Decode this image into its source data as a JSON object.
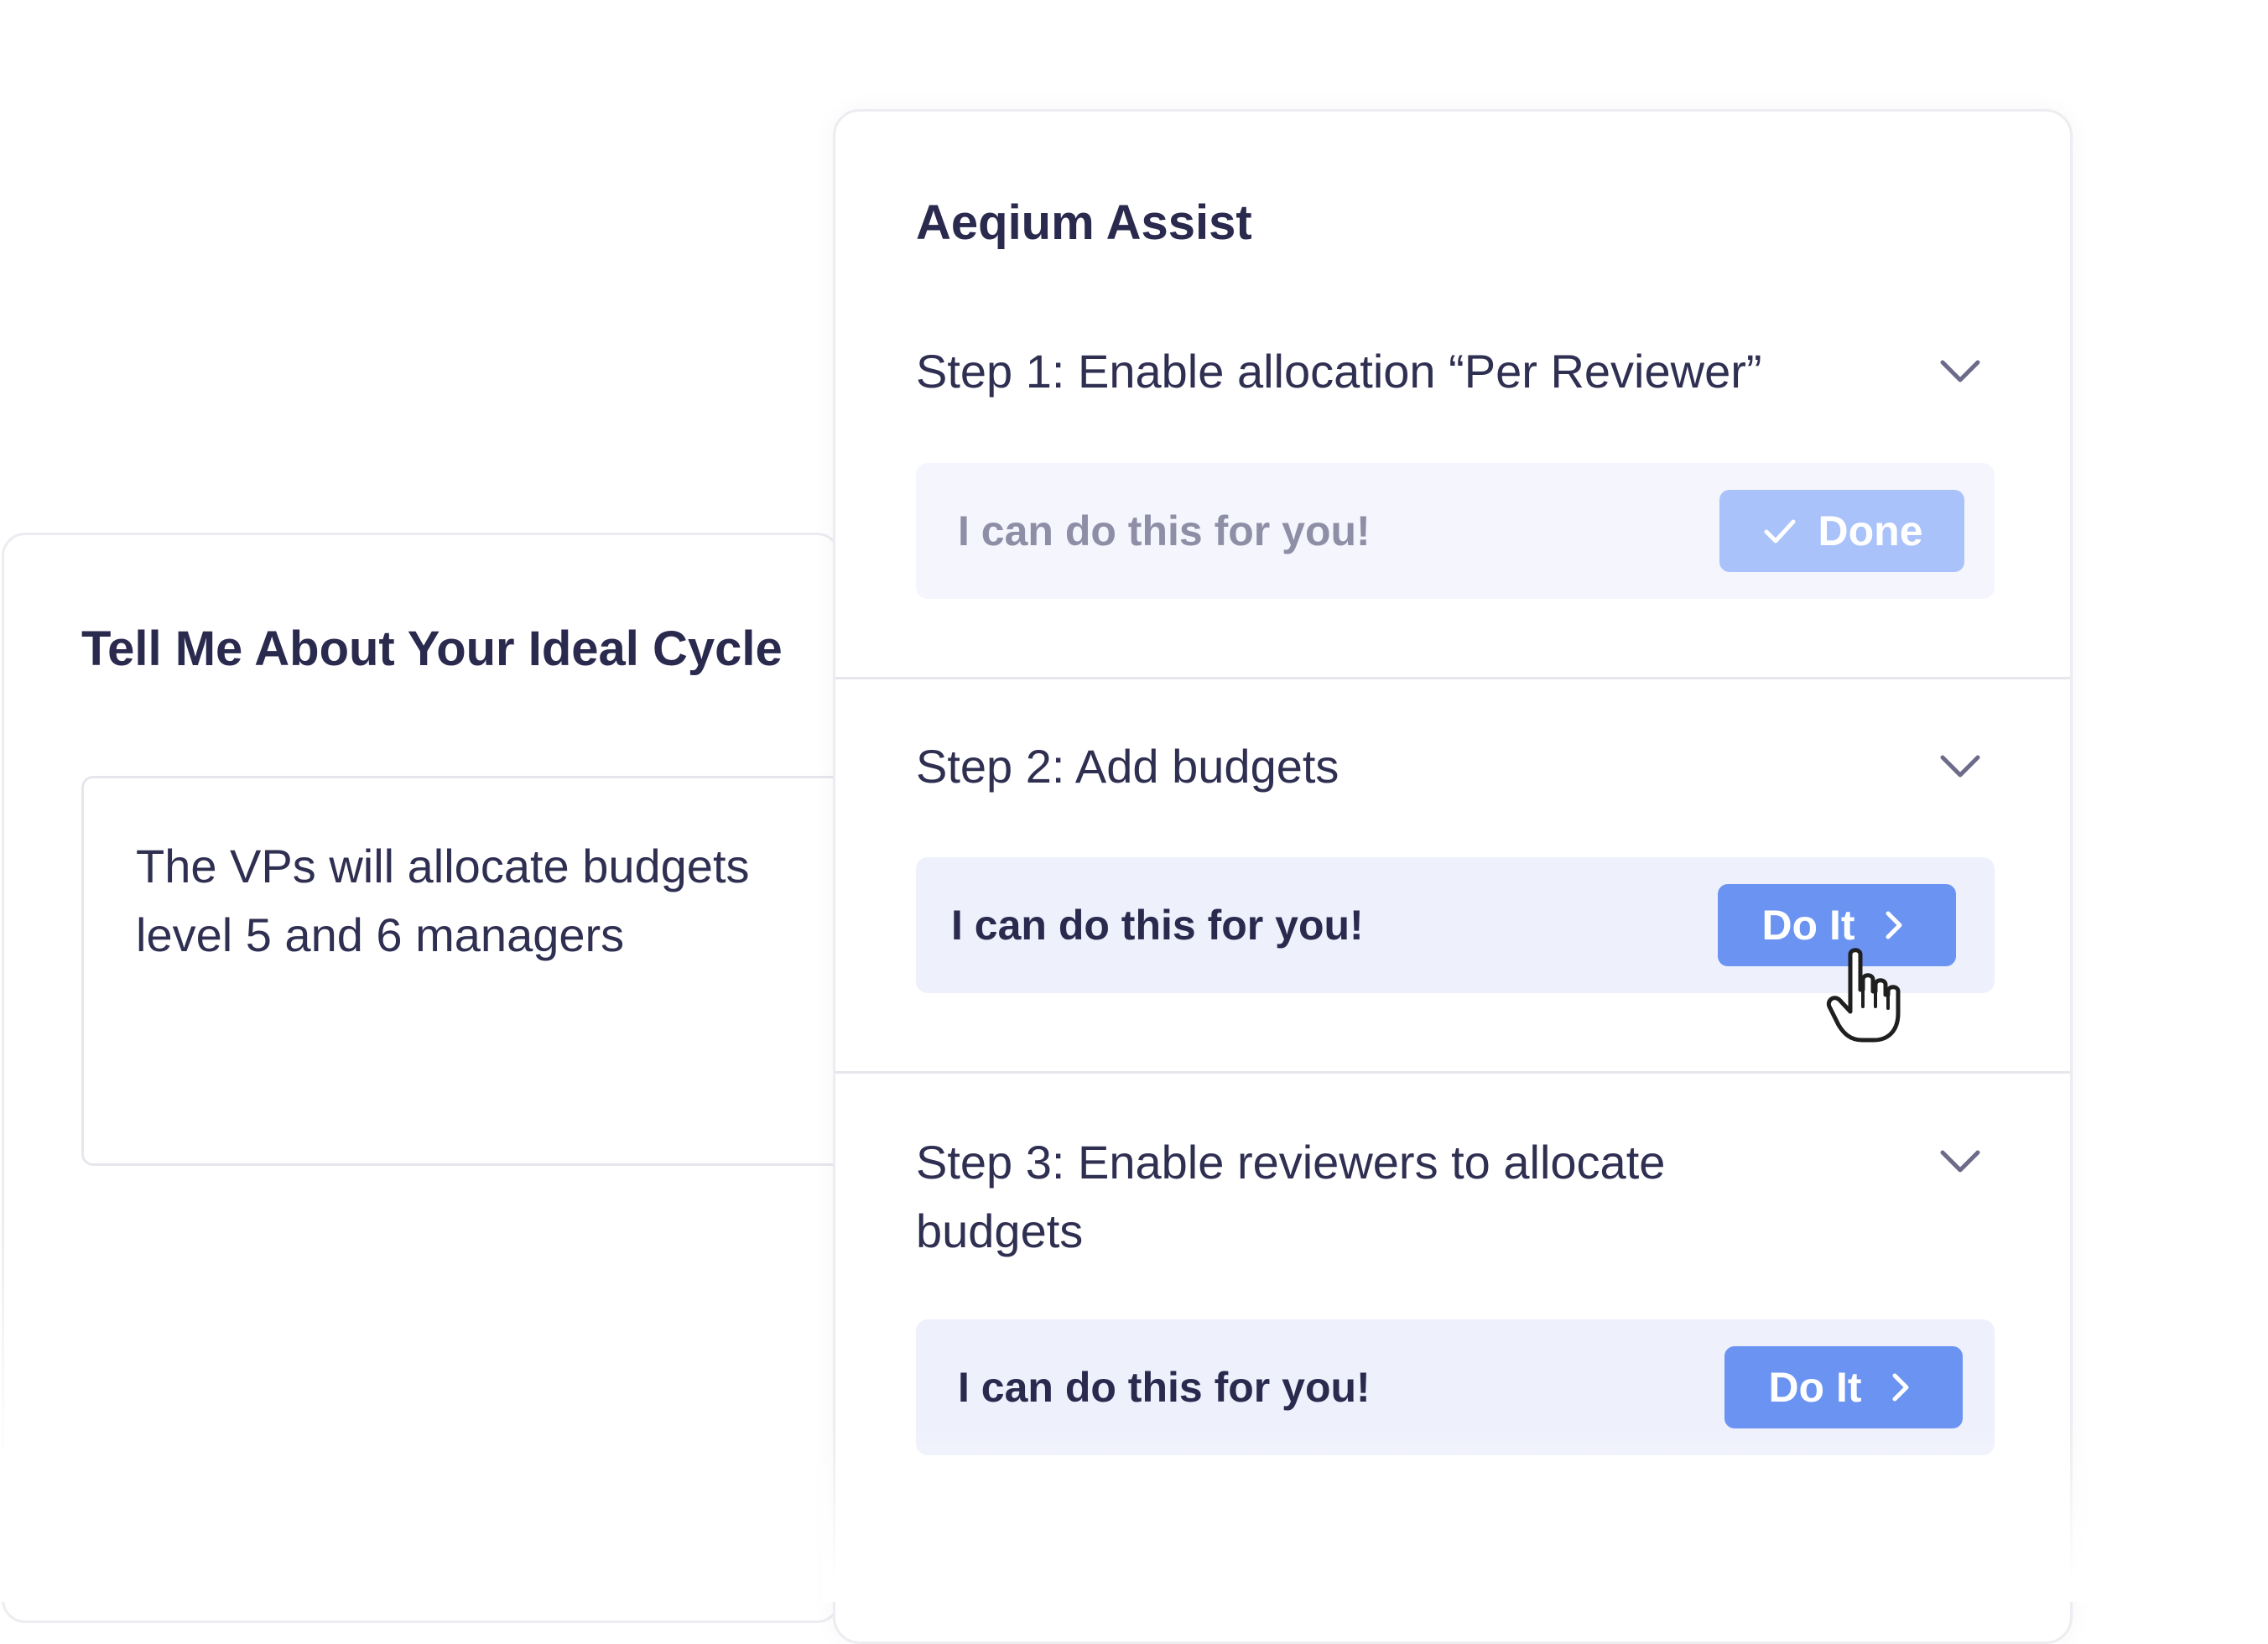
{
  "ideal_cycle": {
    "title": "Tell Me About Your Ideal Cycle",
    "input_value": "The VPs will allocate budgets\nlevel 5 and 6 managers"
  },
  "assist": {
    "title": "Aeqium Assist",
    "steps": [
      {
        "title": "Step 1: Enable allocation “Per Reviewer”",
        "action_text": "I can do this for you!",
        "button_label": "Done",
        "button_icon": "check-icon",
        "status": "done"
      },
      {
        "title": "Step 2: Add budgets",
        "action_text": "I can do this for you!",
        "button_label": "Do It",
        "button_icon": "chevron-right-icon",
        "status": "pending"
      },
      {
        "title": "Step 3: Enable reviewers to allocate\nbudgets",
        "action_text": "I can do this for you!",
        "button_label": "Do It",
        "button_icon": "chevron-right-icon",
        "status": "pending"
      }
    ]
  },
  "colors": {
    "text_dark": "#2a2a4e",
    "button_primary": "#6b93f2",
    "button_done": "#a9c2f9",
    "action_bar_bg": "#eef0fc",
    "action_bar_done_bg": "#f5f6fd",
    "muted_text": "#8e8ea6"
  },
  "cursor": "hand-pointer-icon"
}
